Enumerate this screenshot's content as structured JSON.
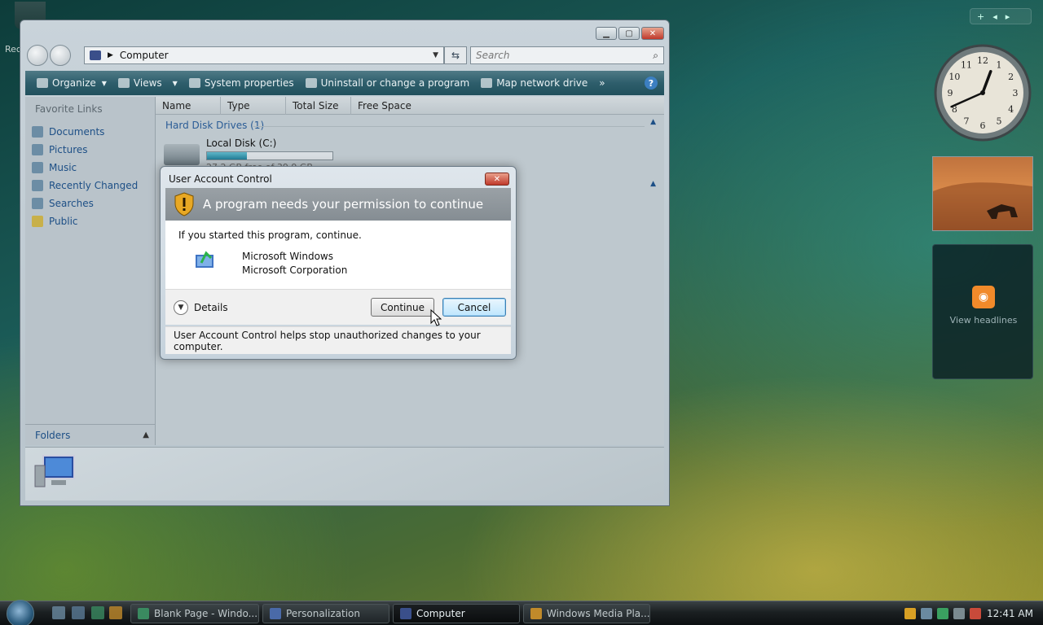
{
  "desktop": {
    "recycle_label": "Rec"
  },
  "explorer": {
    "address": "Computer",
    "search_placeholder": "Search",
    "toolbar": {
      "organize": "Organize",
      "views": "Views",
      "system_properties": "System properties",
      "uninstall": "Uninstall or change a program",
      "map_drive": "Map network drive",
      "more": "»",
      "help": "?"
    },
    "sidebar": {
      "title": "Favorite Links",
      "items": [
        "Documents",
        "Pictures",
        "Music",
        "Recently Changed",
        "Searches",
        "Public"
      ],
      "folders_label": "Folders"
    },
    "columns": [
      "Name",
      "Type",
      "Total Size",
      "Free Space"
    ],
    "group_label": "Hard Disk Drives (1)",
    "drive": {
      "name": "Local Disk (C:)",
      "used_fraction": 0.32,
      "free_text": "27.2 GB free of 39.9 GB"
    }
  },
  "uac": {
    "title": "User Account Control",
    "heading": "A program needs your permission to continue",
    "intro": "If you started this program, continue.",
    "program_name": "Microsoft Windows",
    "publisher": "Microsoft Corporation",
    "details_label": "Details",
    "continue_label": "Continue",
    "cancel_label": "Cancel",
    "footer": "User Account Control helps stop unauthorized changes to your computer."
  },
  "gadgets": {
    "bar_plus": "+",
    "feeds_label": "View headlines",
    "clock": {
      "hour": 12,
      "minute": 41
    }
  },
  "taskbar": {
    "tasks": [
      "Blank Page - Windo...",
      "Personalization",
      "Computer",
      "Windows Media Pla..."
    ],
    "time": "12:41 AM"
  },
  "colors": {
    "toolbar": "#2e5e6c",
    "link": "#1d4f86",
    "close": "#c0392b",
    "rss": "#f18a2a"
  }
}
